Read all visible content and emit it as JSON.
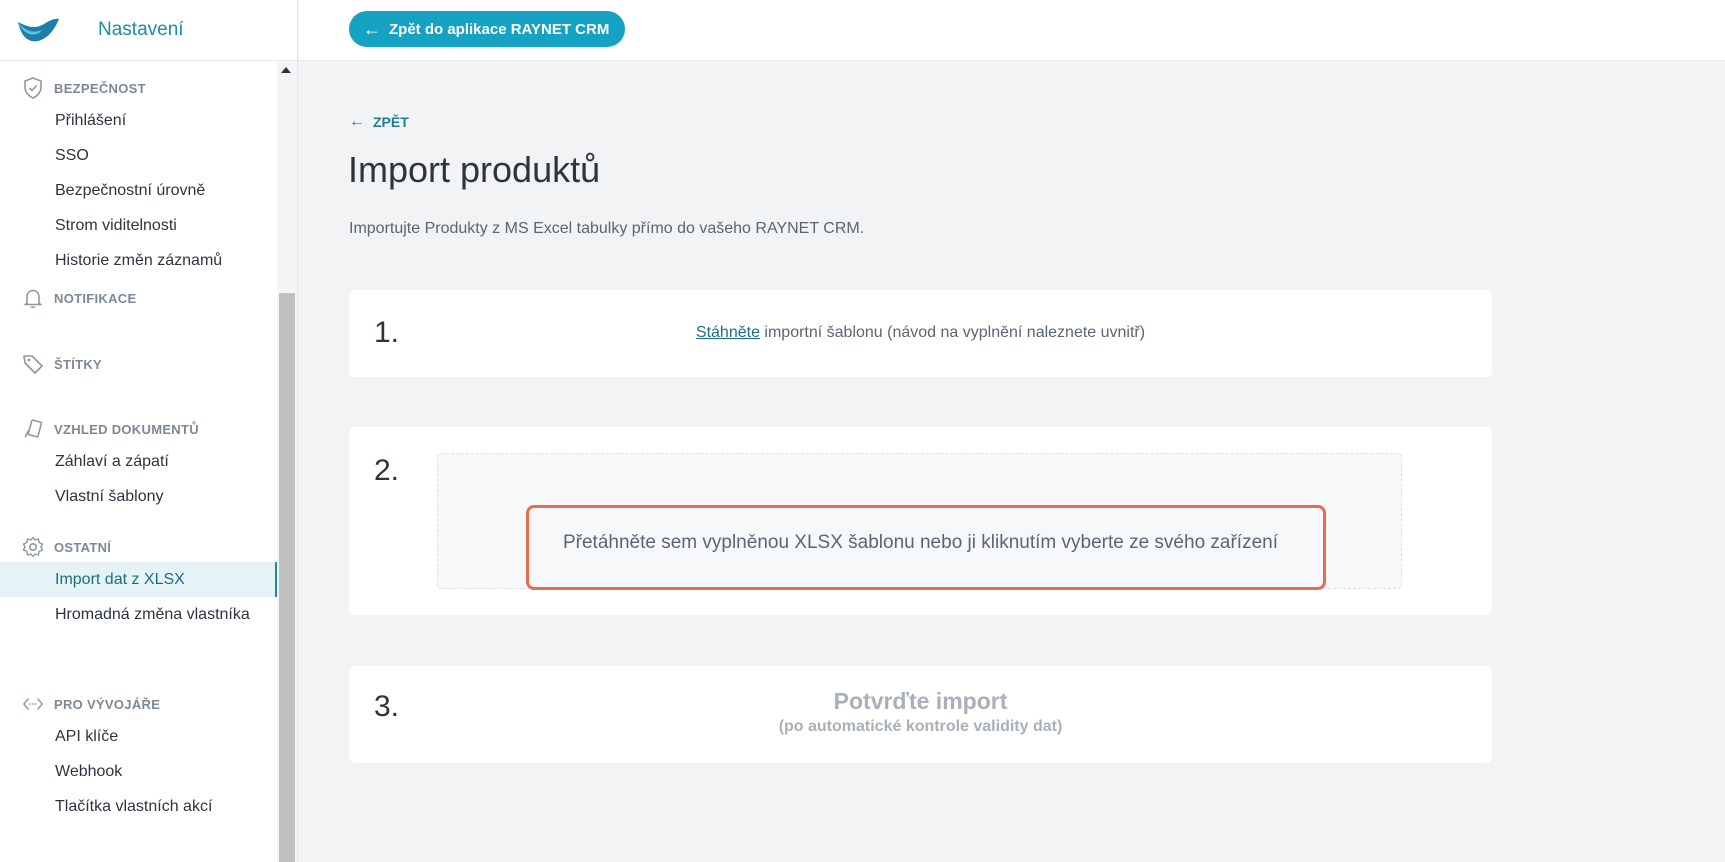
{
  "app": {
    "title": "Nastavení"
  },
  "topbar": {
    "back_button": "Zpět do aplikace RAYNET CRM"
  },
  "sidebar": {
    "sections": [
      {
        "label": "BEZPEČNOST",
        "icon": "shield-icon",
        "items": [
          "Přihlášení",
          "SSO",
          "Bezpečnostní úrovně",
          "Strom viditelnosti",
          "Historie změn záznamů"
        ]
      },
      {
        "label": "NOTIFIKACE",
        "icon": "bell-icon",
        "items": []
      },
      {
        "label": "ŠTÍTKY",
        "icon": "tag-icon",
        "items": []
      },
      {
        "label": "VZHLED DOKUMENTŮ",
        "icon": "brush-icon",
        "items": [
          "Záhlaví a zápatí",
          "Vlastní šablony"
        ]
      },
      {
        "label": "OSTATNÍ",
        "icon": "gear-icon",
        "items": [
          "Import dat z XLSX",
          "Hromadná změna vlastníka"
        ]
      },
      {
        "label": "PRO VÝVOJÁŘE",
        "icon": "code-icon",
        "items": [
          "API klíče",
          "Webhook",
          "Tlačítka vlastních akcí"
        ]
      }
    ],
    "active_item": "Import dat z XLSX"
  },
  "main": {
    "back_link": "ZPĚT",
    "title": "Import produktů",
    "intro": "Importujte Produkty z MS Excel tabulky přímo do vašeho RAYNET CRM.",
    "step1": {
      "number": "1.",
      "link": "Stáhněte",
      "text": " importní šablonu (návod na vyplnění naleznete uvnitř)"
    },
    "step2": {
      "number": "2.",
      "dropzone_text": "Přetáhněte sem vyplněnou XLSX šablonu nebo ji kliknutím vyberte ze svého zařízení"
    },
    "step3": {
      "number": "3.",
      "title": "Potvrďte import",
      "subtitle": "(po automatické kontrole validity dat)"
    }
  },
  "colors": {
    "accent": "#16a2c2",
    "highlight": "#ea6b54"
  }
}
